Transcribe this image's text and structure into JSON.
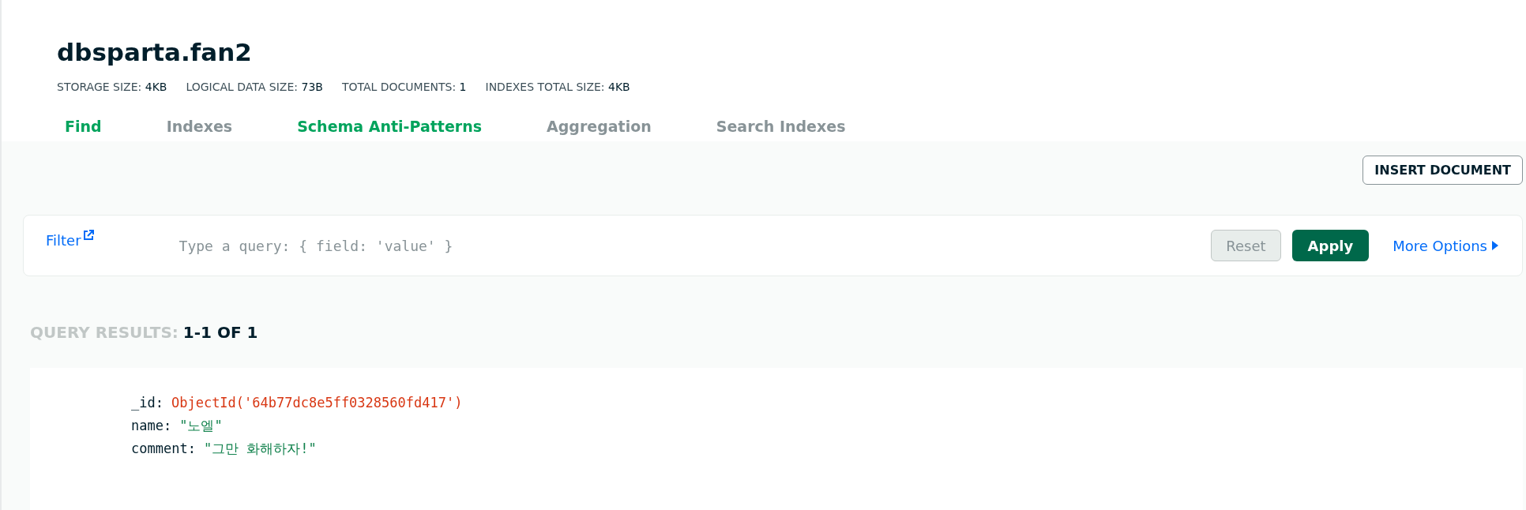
{
  "header": {
    "title": "dbsparta.fan2",
    "stats": [
      {
        "label": "STORAGE SIZE:",
        "value": "4KB"
      },
      {
        "label": "LOGICAL DATA SIZE:",
        "value": "73B"
      },
      {
        "label": "TOTAL DOCUMENTS:",
        "value": "1"
      },
      {
        "label": "INDEXES TOTAL SIZE:",
        "value": "4KB"
      }
    ]
  },
  "tabs": [
    {
      "label": "Find",
      "selected": true
    },
    {
      "label": "Indexes",
      "selected": false
    },
    {
      "label": "Schema Anti-Patterns",
      "selected": true
    },
    {
      "label": "Aggregation",
      "selected": false
    },
    {
      "label": "Search Indexes",
      "selected": false
    }
  ],
  "insert_button": "INSERT DOCUMENT",
  "filter": {
    "label": "Filter",
    "placeholder": "Type a query: { field: 'value' }",
    "reset": "Reset",
    "reset_disabled": true,
    "apply": "Apply",
    "more_options": "More Options"
  },
  "results": {
    "label": "QUERY RESULTS:",
    "range": "1-1 OF 1"
  },
  "document": [
    {
      "key": "_id:",
      "value": "ObjectId('64b77dc8e5ff0328560fd417')",
      "kind": "objectid"
    },
    {
      "key": "name:",
      "value": "\"노엘\"",
      "kind": "string"
    },
    {
      "key": "comment:",
      "value": "\"그만 화해하자!\"",
      "kind": "string"
    }
  ]
}
